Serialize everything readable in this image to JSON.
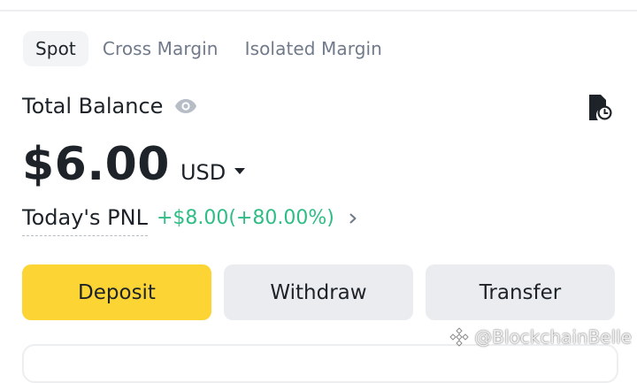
{
  "tabs": [
    {
      "label": "Spot",
      "active": true
    },
    {
      "label": "Cross Margin",
      "active": false
    },
    {
      "label": "Isolated Margin",
      "active": false
    }
  ],
  "balance": {
    "label": "Total Balance",
    "amount": "$6.00",
    "currency": "USD"
  },
  "pnl": {
    "label": "Today's PNL",
    "value": "+$8.00(+80.00%)"
  },
  "actions": {
    "deposit": "Deposit",
    "withdraw": "Withdraw",
    "transfer": "Transfer"
  },
  "watermark": "@BlockchainBelle",
  "icons": {
    "eye": "eye-icon",
    "history": "order-history-icon",
    "currency_dropdown": "caret-down-icon",
    "pnl_arrow": "chevron-right-icon"
  },
  "colors": {
    "accent_yellow": "#fcd535",
    "positive_green": "#2ebd85",
    "text_primary": "#1e2329",
    "text_secondary": "#707a8a",
    "button_gray": "#eaecef"
  }
}
